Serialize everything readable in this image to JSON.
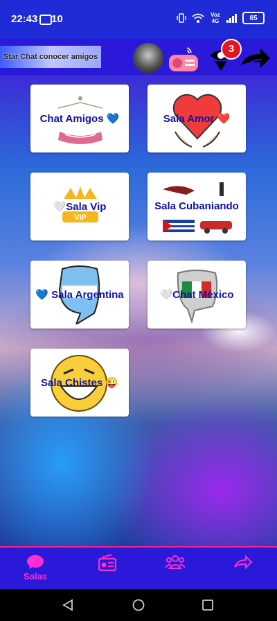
{
  "status_bar": {
    "time": "22:43",
    "notification_count": "10",
    "network": "Voz 4G",
    "battery": "65"
  },
  "header": {
    "logo_text": "Star Chat conocer amigos",
    "notification_badge": "3"
  },
  "rooms": [
    {
      "label": "Chat Amigos 💙"
    },
    {
      "label": "Sala Amor ❤️"
    },
    {
      "label": "🤍Sala Vip"
    },
    {
      "label": "Sala Cubaniando"
    },
    {
      "label": "💙 Sala Argentina"
    },
    {
      "label": "🤍Chat México"
    },
    {
      "label": "Sala Chistes 😜"
    }
  ],
  "bottom_nav": {
    "items": [
      {
        "label": "Salas",
        "icon": "chat-bubble-icon",
        "active": true
      },
      {
        "label": "",
        "icon": "radio-icon"
      },
      {
        "label": "",
        "icon": "group-icon"
      },
      {
        "label": "",
        "icon": "share-arrow-icon"
      }
    ]
  },
  "colors": {
    "bar": "#2a19d9",
    "accent": "#ff2ed2",
    "label": "#1111aa"
  }
}
